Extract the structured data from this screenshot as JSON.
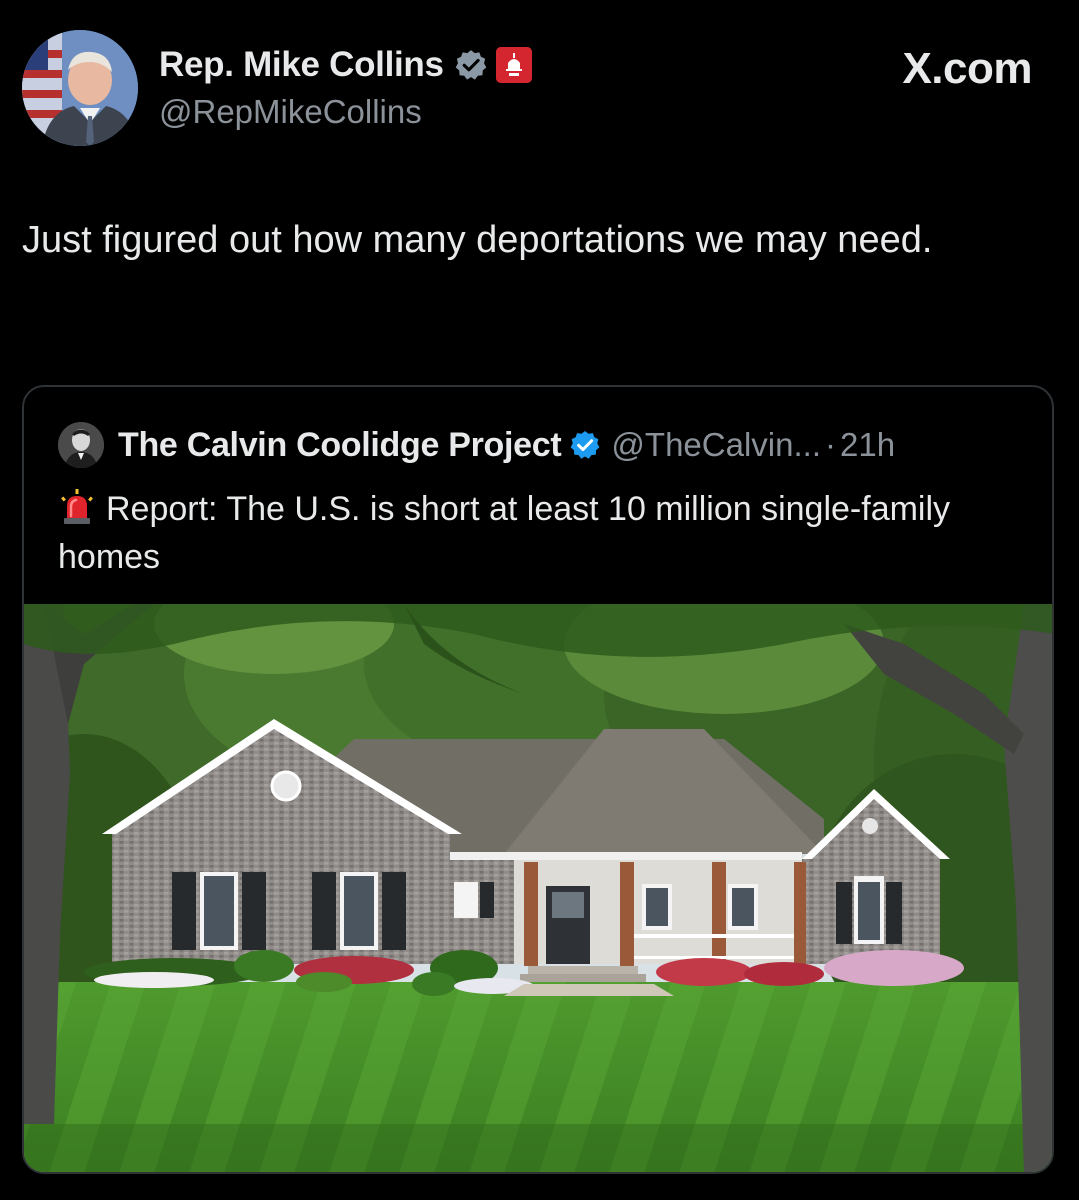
{
  "tweet": {
    "author_name": "Rep. Mike Collins",
    "author_handle": "@RepMikeCollins",
    "site": "X.com",
    "text": "Just figured out how many deportations we may need.",
    "icons": {
      "avatar": "profile-photo",
      "verified": "verified-check-icon",
      "affiliation": "capitol-gop-badge-icon"
    }
  },
  "quote": {
    "author_name": "The Calvin Coolidge Project",
    "author_handle": "@TheCalvin...",
    "separator": "·",
    "time": "21h",
    "text": "Report: The U.S. is short at least 10 million single-family homes",
    "icons": {
      "text_prefix": "siren-icon",
      "media": "house-photo"
    }
  },
  "colors": {
    "background": "#000000",
    "text": "#e7e9ea",
    "secondary_text": "#8b9299",
    "verified_blue": "#1d9bf0",
    "badge_red": "#d3262f",
    "border": "#2f3336"
  }
}
